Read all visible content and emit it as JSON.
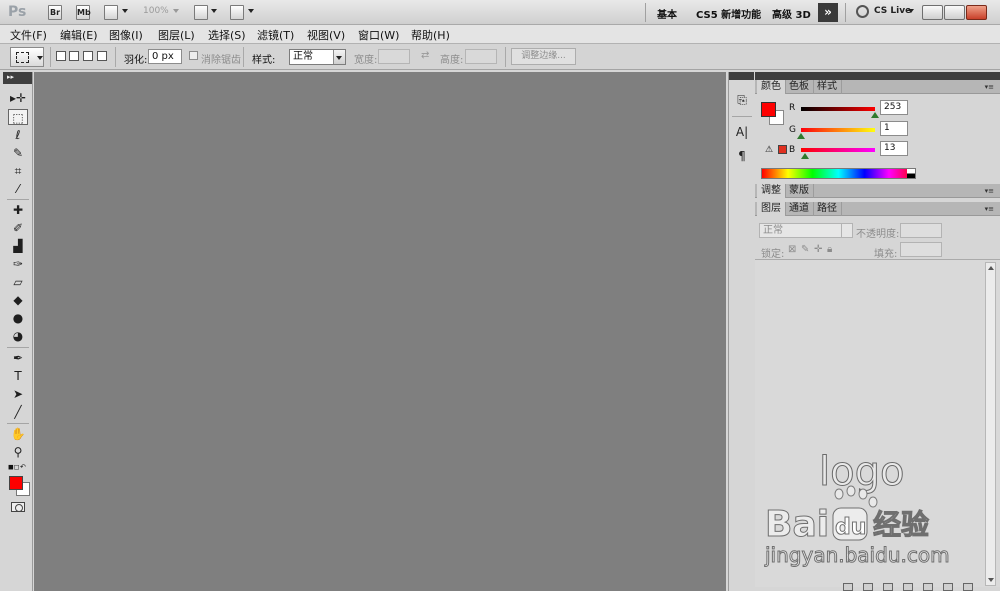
{
  "appbar": {
    "logo": "Ps",
    "bridge_label": "Br",
    "minibridge_label": "Mb",
    "zoom": "100%",
    "workspaces": [
      "基本",
      "CS5 新增功能",
      "高级 3D"
    ],
    "more_label": "»",
    "cslive": "CS Live"
  },
  "menu": {
    "items": [
      "文件(F)",
      "编辑(E)",
      "图像(I)",
      "图层(L)",
      "选择(S)",
      "滤镜(T)",
      "视图(V)",
      "窗口(W)",
      "帮助(H)"
    ]
  },
  "options": {
    "feather_label": "羽化:",
    "feather_value": "0 px",
    "antialias_label": "消除锯齿",
    "style_label": "样式:",
    "style_value": "正常",
    "width_label": "宽度:",
    "height_label": "高度:",
    "refine_label": "调整边缘..."
  },
  "panels": {
    "color_tabs": [
      "颜色",
      "色板",
      "样式"
    ],
    "channels": [
      {
        "label": "R",
        "value": "253"
      },
      {
        "label": "G",
        "value": "1"
      },
      {
        "label": "B",
        "value": "13"
      }
    ],
    "adjust_tabs": [
      "调整",
      "蒙版"
    ],
    "layer_tabs": [
      "图层",
      "通道",
      "路径"
    ],
    "blend_mode": "正常",
    "opacity_label": "不透明度:",
    "lock_label": "锁定:",
    "fill_label": "填充:"
  },
  "watermark": {
    "logo_text": "logo",
    "brand_text": "Bai",
    "brand_suffix": "du",
    "brand_cn": "经验",
    "url": "jingyan.baidu.com"
  },
  "colors": {
    "foreground": "#fd0000",
    "background": "#ffffff",
    "canvas": "#7f7f7f"
  }
}
